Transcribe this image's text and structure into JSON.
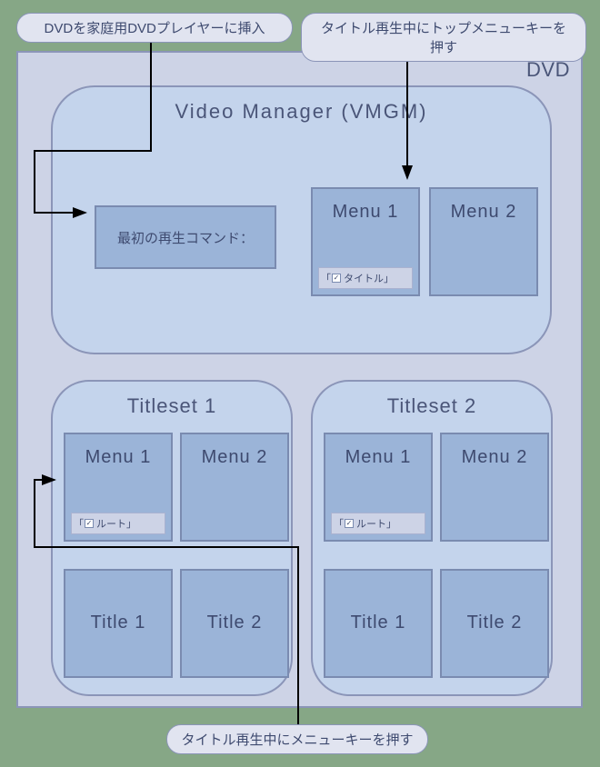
{
  "callouts": {
    "top_left": "DVDを家庭用DVDプレイヤーに挿入",
    "top_right": "タイトル再生中にトップメニューキーを押す",
    "bottom": "タイトル再生中にメニューキーを押す"
  },
  "dvd": {
    "label": "DVD",
    "vmgm": {
      "title": "Video  Manager (VMGM)",
      "first_command": "最初の再生コマンド：",
      "menus": {
        "menu1": {
          "label": "Menu 1",
          "sub_prefix": "「",
          "sub_text": "タイトル」",
          "checked": true
        },
        "menu2": {
          "label": "Menu 2"
        }
      }
    },
    "titlesets": {
      "ts1": {
        "title": "Titleset 1",
        "menu1": {
          "label": "Menu 1",
          "sub_prefix": "「",
          "sub_text": "ルート」",
          "checked": true
        },
        "menu2": {
          "label": "Menu 2"
        },
        "title1": {
          "label": "Title 1"
        },
        "title2": {
          "label": "Title 2"
        }
      },
      "ts2": {
        "title": "Titleset 2",
        "menu1": {
          "label": "Menu 1",
          "sub_prefix": "「",
          "sub_text": "ルート」",
          "checked": true
        },
        "menu2": {
          "label": "Menu 2"
        },
        "title1": {
          "label": "Title 1"
        },
        "title2": {
          "label": "Title 2"
        }
      }
    }
  }
}
